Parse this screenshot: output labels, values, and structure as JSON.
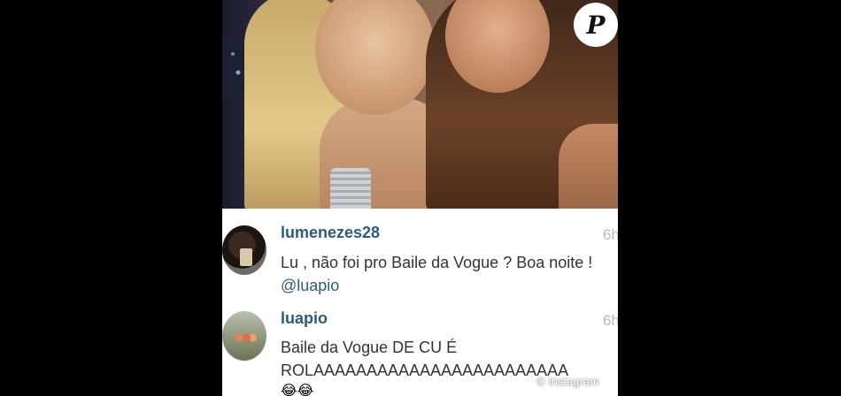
{
  "logo": {
    "letter": "P"
  },
  "comments": [
    {
      "username": "lumenezes28",
      "time": "6h",
      "text_before": "Lu , não foi pro Baile da Vogue ? Boa noite ! ",
      "mention": "@luapio"
    },
    {
      "username": "luapio",
      "time": "6h",
      "text": "Baile da Vogue DE CU É ROLAAAAAAAAAAAAAAAAAAAAAAAA",
      "emoji": "😂😂"
    }
  ],
  "watermark": "© Instagram"
}
